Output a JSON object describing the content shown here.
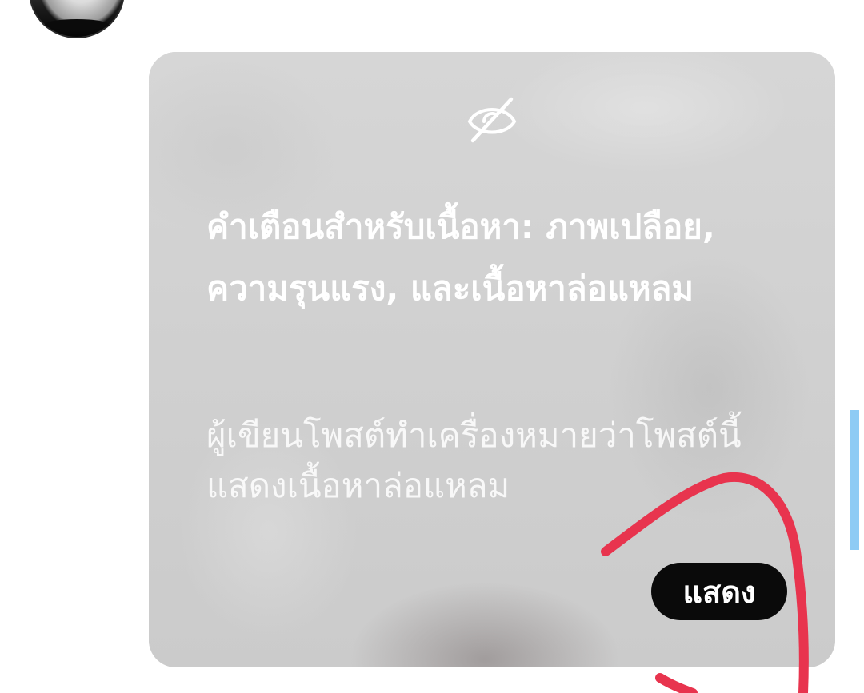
{
  "author": {
    "avatar_icon": "profile-photo"
  },
  "content_warning": {
    "icon": "eye-off-icon",
    "title": "คำเตือนสำหรับเนื้อหา: ภาพเปลือย, ความรุนแรง, และเนื้อหาล่อแหลม",
    "description": "ผู้เขียนโพสต์ทำเครื่องหมายว่าโพสต์นี้แสดงเนื้อหาล่อแหลม",
    "show_button_label": "แสดง"
  },
  "colors": {
    "overlay": "#d4d4d4",
    "button_bg": "#0a0a0a",
    "text": "#ffffff",
    "annotation_stroke": "#e8344e",
    "scroll_indicator": "#8ecbf4"
  }
}
